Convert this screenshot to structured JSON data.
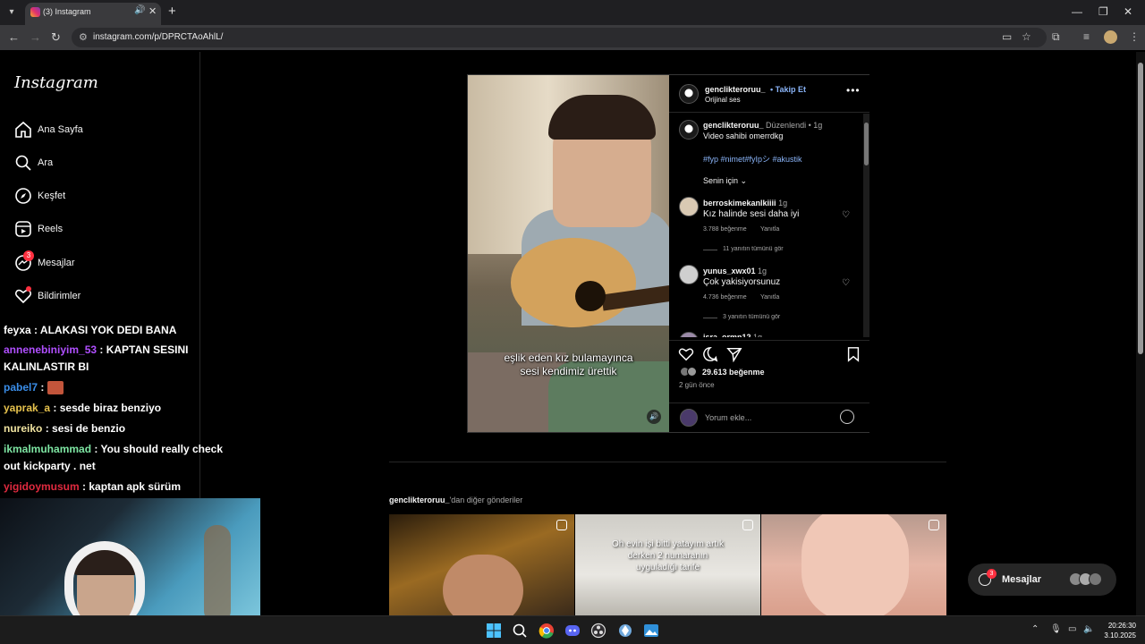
{
  "browser": {
    "tab_title": "(3) Instagram",
    "url": "instagram.com/p/DPRCTAoAhlL/",
    "new_tab": "+",
    "tab_close": "✕",
    "window_min": "—",
    "window_max": "❐",
    "window_close": "✕"
  },
  "sidebar": {
    "logo": "Instagram",
    "items": [
      {
        "label": "Ana Sayfa",
        "icon": "home-icon"
      },
      {
        "label": "Ara",
        "icon": "search-icon"
      },
      {
        "label": "Keşfet",
        "icon": "compass-icon"
      },
      {
        "label": "Reels",
        "icon": "reels-icon"
      },
      {
        "label": "Mesajlar",
        "icon": "messenger-icon",
        "badge": "3"
      },
      {
        "label": "Bildirimler",
        "icon": "heart-icon"
      }
    ]
  },
  "chat": [
    {
      "user": "feyxa",
      "text": ": ALAKASI YOK DEDI BANA",
      "color": "#ffffff"
    },
    {
      "user": "annenebiniyim_53",
      "text": ": KAPTAN SESINI",
      "cont": "KALINLASTIR BI",
      "color": "#b04fff"
    },
    {
      "user": "pabel7",
      "text": ":",
      "color": "#3a8de8",
      "emote": true
    },
    {
      "user": "yaprak_a",
      "text": ": sesde biraz benziyo",
      "color": "#e6c24d"
    },
    {
      "user": "nureiko",
      "text": ": sesi de benzio",
      "color": "#f0e3a0"
    },
    {
      "user": "ikmalmuhammad",
      "text": ": You should really check",
      "cont": "out kickparty . net",
      "color": "#7ee6a3"
    },
    {
      "user": "yigidoymusum",
      "text": ": kaptan apk sürüm",
      "color": "#e02a3f"
    }
  ],
  "post": {
    "author": "genclikteroruu_",
    "follow_label": "Takip Et",
    "audio": "Orijinal ses",
    "edited_label": "Düzenlendi",
    "edited_time": "1g",
    "caption_text": "Video sahibi omerrdkg",
    "hashtags": "#fyp #nimet#fyIpシ #akustik",
    "for_you": "Senin için",
    "video_caption_1": "eşlik eden kız  bulamayınca",
    "video_caption_2": "sesi kendimiz ürettik",
    "comments": [
      {
        "user": "berroskimekanlkiiii",
        "time": "1g",
        "text": "Kız halinde sesi daha iyi",
        "likes": "3.788 beğenme",
        "reply": "Yanıtla",
        "view_replies": "11 yanıtın tümünü gör"
      },
      {
        "user": "yunus_xwx01",
        "time": "1g",
        "text": "Çok yakisiyorsunuz",
        "likes": "4.736 beğenme",
        "reply": "Yanıtla",
        "view_replies": "3 yanıtın tümünü gör"
      }
    ],
    "partial_user": "isra_ormn12",
    "partial_time": "1g",
    "like_count": "29.613 beğenme",
    "time_ago": "2 gün önce",
    "comment_placeholder": "Yorum ekle..."
  },
  "more_posts": {
    "owner": "genclikteroruu_",
    "suffix": "'dan diğer gönderiler",
    "thumb2_caption_1": "Oh evin işi bitti yatayım artık",
    "thumb2_caption_2": "derken 2 numaranın",
    "thumb2_caption_3": "uyguladığı tarife"
  },
  "messages_pill": {
    "label": "Mesajlar",
    "badge": "3"
  },
  "taskbar": {
    "time": "20:26:30",
    "date": "3.10.2025"
  }
}
